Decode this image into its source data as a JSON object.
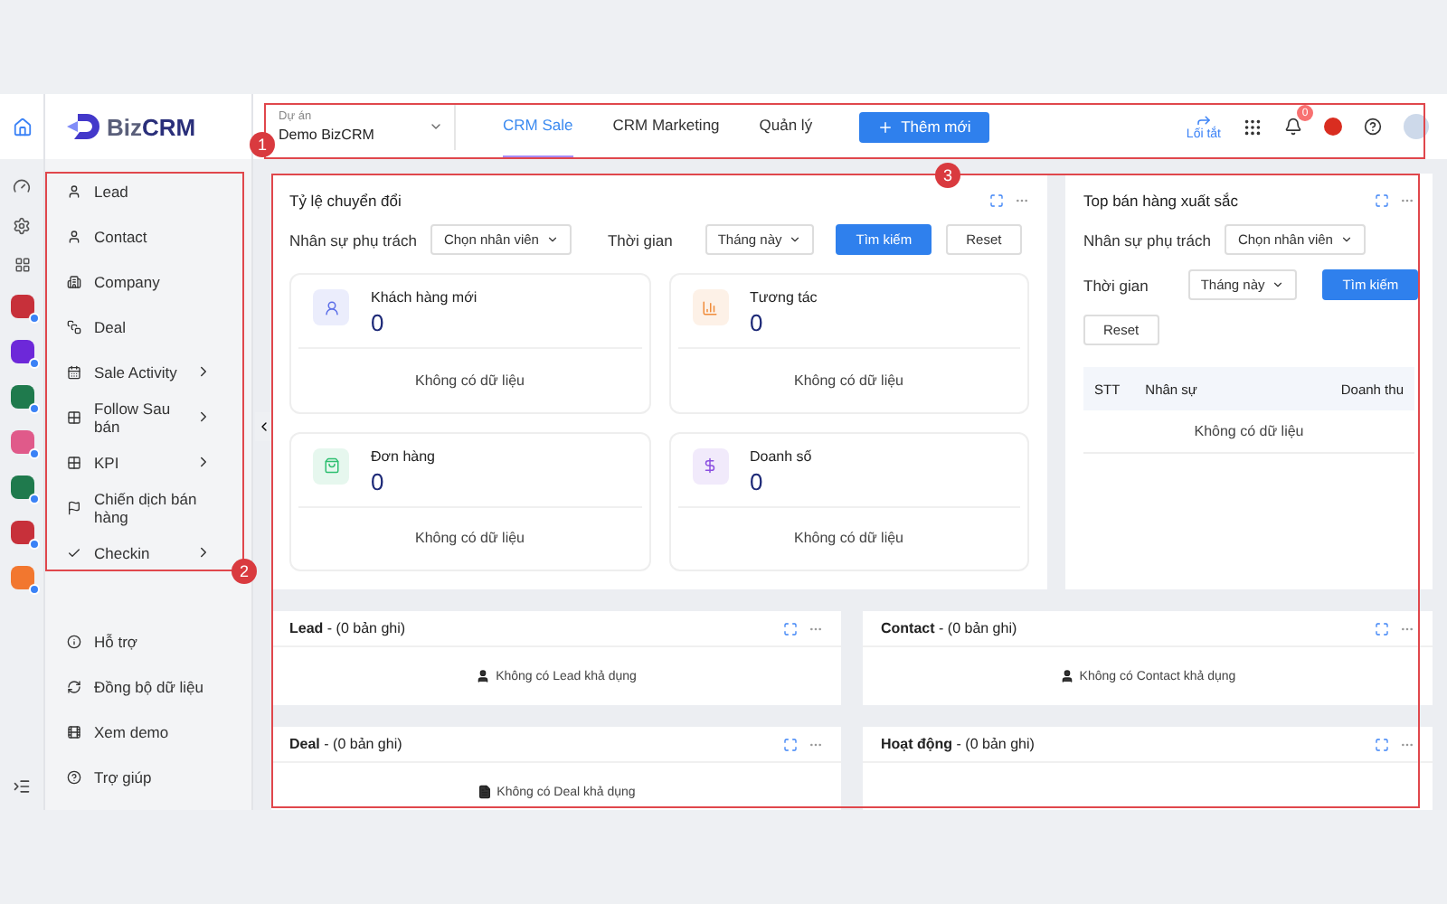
{
  "logo": {
    "part_1": "Biz",
    "part_2": "CRM"
  },
  "project": {
    "label": "Dự án",
    "value": "Demo BizCRM"
  },
  "tabs": [
    {
      "label": "CRM Sale",
      "selected": true
    },
    {
      "label": "CRM Marketing",
      "selected": false
    },
    {
      "label": "Quản lý",
      "selected": false
    }
  ],
  "add_button": "Thêm mới",
  "shortcut": "Lối tắt",
  "notification_count": "0",
  "menu": [
    {
      "label": "Lead",
      "expandable": false
    },
    {
      "label": "Contact",
      "expandable": false
    },
    {
      "label": "Company",
      "expandable": false
    },
    {
      "label": "Deal",
      "expandable": false
    },
    {
      "label": "Sale Activity",
      "expandable": true
    },
    {
      "label": "Follow Sau bán",
      "expandable": true
    },
    {
      "label": "KPI",
      "expandable": true
    },
    {
      "label": "Chiến dịch bán hàng",
      "expandable": false
    },
    {
      "label": "Checkin",
      "expandable": true
    }
  ],
  "bottom_menu": [
    "Hỗ trợ",
    "Đồng bộ dữ liệu",
    "Xem demo",
    "Trợ giúp"
  ],
  "conversion": {
    "title": "Tỷ lệ chuyển đổi",
    "staff_label": "Nhân sự phụ trách",
    "staff_select": "Chọn nhân viên",
    "time_label": "Thời gian",
    "time_select": "Tháng này",
    "search_button": "Tìm kiếm",
    "reset_button": "Reset",
    "cards": [
      {
        "title": "Khách hàng mới",
        "value": "0",
        "empty": "Không có dữ liệu",
        "color": "#5b6ee8"
      },
      {
        "title": "Tương tác",
        "value": "0",
        "empty": "Không có dữ liệu",
        "color": "#f08c3a"
      },
      {
        "title": "Đơn hàng",
        "value": "0",
        "empty": "Không có dữ liệu",
        "color": "#2fbf71"
      },
      {
        "title": "Doanh số",
        "value": "0",
        "empty": "Không có dữ liệu",
        "color": "#8b4fe0"
      }
    ]
  },
  "top_sales": {
    "title": "Top bán hàng xuất sắc",
    "staff_label": "Nhân sự phụ trách",
    "staff_select": "Chọn nhân viên",
    "time_label": "Thời gian",
    "time_select": "Tháng này",
    "search_button": "Tìm kiếm",
    "reset_button": "Reset",
    "columns": [
      "STT",
      "Nhân sự",
      "Doanh thu"
    ],
    "empty": "Không có dữ liệu"
  },
  "lists": [
    {
      "title": "Lead",
      "count": "- (0 bản ghi)",
      "empty": "Không có Lead khả dụng"
    },
    {
      "title": "Contact",
      "count": "- (0 bản ghi)",
      "empty": "Không có Contact khả dụng"
    },
    {
      "title": "Deal",
      "count": "- (0 bản ghi)",
      "empty": "Không có Deal khả dụng"
    },
    {
      "title": "Hoạt động",
      "count": "- (0 bản ghi)"
    }
  ],
  "annotations": [
    "1",
    "2",
    "3"
  ]
}
